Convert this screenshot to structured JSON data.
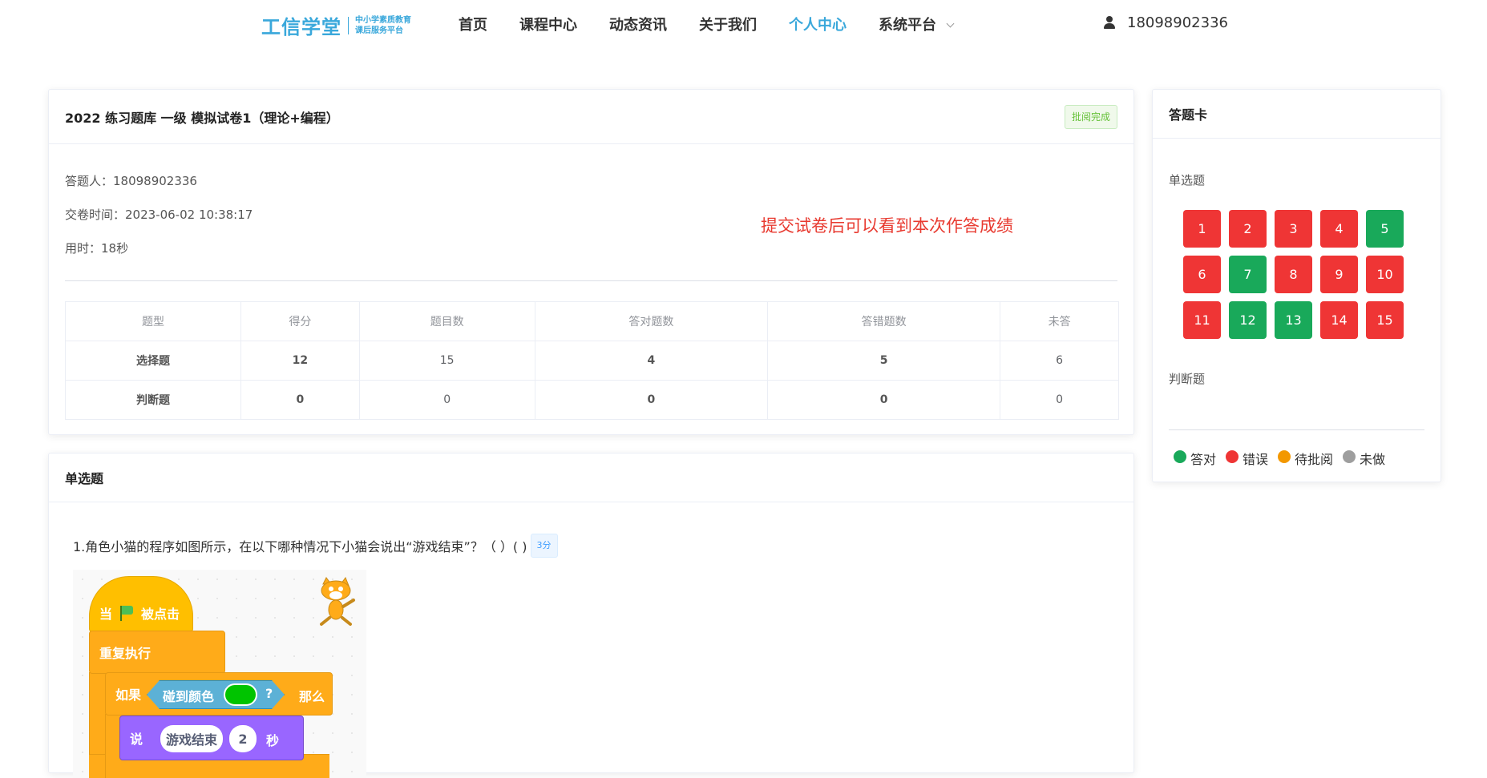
{
  "header": {
    "logo_main": "工信学堂",
    "logo_sub_1": "中小学素质教育",
    "logo_sub_2": "课后服务平台",
    "nav": [
      "首页",
      "课程中心",
      "动态资讯",
      "关于我们",
      "个人中心",
      "系统平台"
    ],
    "active_nav": "个人中心",
    "user_phone": "18098902336"
  },
  "exam": {
    "title": "2022 练习题库 一级 模拟试卷1（理论+编程）",
    "status_badge": "批阅完成",
    "answerer": "答题人：18098902336",
    "submit_time": "交卷时间：2023-06-02 10:38:17",
    "duration": "用时：18秒",
    "notice": "提交试卷后可以看到本次作答成绩",
    "table": {
      "headers": [
        "题型",
        "得分",
        "题目数",
        "答对题数",
        "答错题数",
        "未答"
      ],
      "rows": [
        [
          "选择题",
          "12",
          "15",
          "4",
          "5",
          "6"
        ],
        [
          "判断题",
          "0",
          "0",
          "0",
          "0",
          "0"
        ]
      ]
    }
  },
  "answer_card": {
    "title": "答题卡",
    "single_label": "单选题",
    "judge_label": "判断题",
    "items": [
      {
        "n": "1",
        "status": "red"
      },
      {
        "n": "2",
        "status": "red"
      },
      {
        "n": "3",
        "status": "red"
      },
      {
        "n": "4",
        "status": "red"
      },
      {
        "n": "5",
        "status": "green"
      },
      {
        "n": "6",
        "status": "red"
      },
      {
        "n": "7",
        "status": "green"
      },
      {
        "n": "8",
        "status": "red"
      },
      {
        "n": "9",
        "status": "red"
      },
      {
        "n": "10",
        "status": "red"
      },
      {
        "n": "11",
        "status": "red"
      },
      {
        "n": "12",
        "status": "green"
      },
      {
        "n": "13",
        "status": "green"
      },
      {
        "n": "14",
        "status": "red"
      },
      {
        "n": "15",
        "status": "red"
      }
    ],
    "legend": [
      {
        "label": "答对",
        "color": "#19a95a"
      },
      {
        "label": "错误",
        "color": "#ef3535"
      },
      {
        "label": "待批阅",
        "color": "#f39800"
      },
      {
        "label": "未做",
        "color": "#9e9e9e"
      }
    ]
  },
  "questions": {
    "section_title": "单选题",
    "q1_text": "1.角色小猫的程序如图所示，在以下哪种情况下小猫会说出“游戏结束”？（ ）( )",
    "q1_points": "3分",
    "scratch": {
      "when_prefix": "当",
      "when_suffix": "被点击",
      "forever": "重复执行",
      "if": "如果",
      "touching_color": "碰到颜色",
      "qmark": "?",
      "then": "那么",
      "say": "说",
      "say_text": "游戏结束",
      "say_secs": "2",
      "secs_unit": "秒"
    }
  }
}
